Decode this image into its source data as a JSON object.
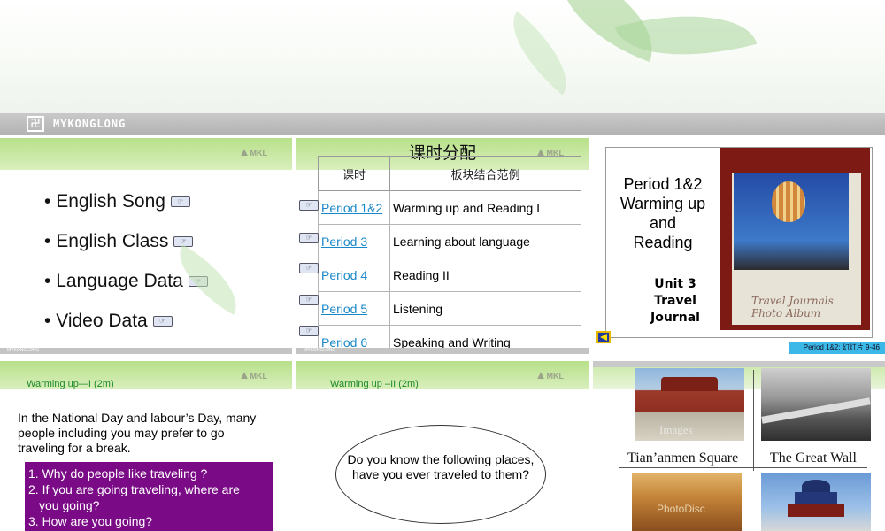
{
  "header": {
    "logo_text": "MYKONGLONG",
    "mkl": "MKL"
  },
  "slide1": {
    "items": [
      "English Song",
      "English Class",
      "Language Data",
      "Video Data"
    ]
  },
  "slide2": {
    "title": "课时分配",
    "columns": [
      "课时",
      "板块结合范例"
    ],
    "rows": [
      {
        "period": "Period 1&2",
        "content": "Warming up and Reading I"
      },
      {
        "period": "Period 3",
        "content": "Learning about language"
      },
      {
        "period": "Period 4",
        "content": "Reading II"
      },
      {
        "period": "Period 5",
        "content": "Listening"
      },
      {
        "period": "Period 6",
        "content": "Speaking and Writing"
      }
    ]
  },
  "slide3": {
    "title_lines": [
      "Period 1&2",
      "Warming up",
      "and",
      "Reading"
    ],
    "unit_lines": [
      "Unit 3",
      "Travel",
      "Journal"
    ],
    "album_caption": [
      "Travel Journals",
      "Photo Album"
    ],
    "slide_info": "Period 1&2: 幻灯片 9-46"
  },
  "slide4": {
    "title": "Warming up—I (2m)",
    "paragraph": "In the National Day and labour’s Day, many people including you may prefer to go traveling for a break.",
    "questions": [
      "1. Why do  people like traveling ?",
      "2. If you are going traveling, where are",
      "you  going?",
      "3. How are you  going?"
    ]
  },
  "slide5": {
    "title": "Warming up –II (2m)",
    "question": "Do you know the following places, have you ever traveled to them?"
  },
  "slide6": {
    "captions": [
      "Tian’anmen Square",
      "The Great Wall"
    ],
    "watermarks": [
      "Images",
      "PhotoDisc"
    ]
  },
  "colors": {
    "green_bar": "#b8e08a",
    "purple_box": "#7a0a86",
    "link": "#1a88c8",
    "slide_info_bg": "#3bb7e8"
  }
}
